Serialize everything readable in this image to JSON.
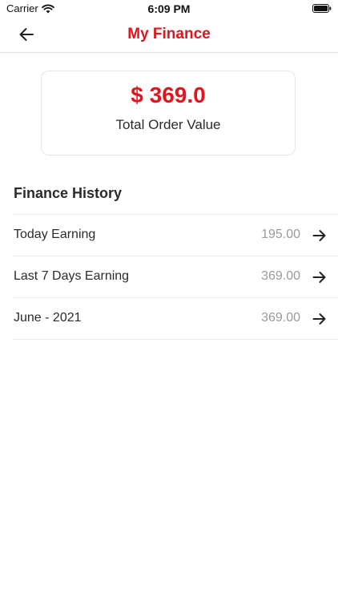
{
  "status_bar": {
    "carrier": "Carrier",
    "time": "6:09 PM"
  },
  "nav": {
    "title": "My Finance",
    "back_icon": "arrow-left-icon"
  },
  "summary": {
    "amount": "$ 369.0",
    "label": "Total Order Value"
  },
  "history": {
    "title": "Finance History",
    "rows": [
      {
        "label": "Today Earning",
        "value": "195.00"
      },
      {
        "label": "Last 7 Days Earning",
        "value": "369.00"
      },
      {
        "label": "June - 2021",
        "value": "369.00"
      }
    ]
  },
  "colors": {
    "accent": "#e3141b",
    "muted": "#9a9a9a",
    "text": "#2b2b2b"
  }
}
